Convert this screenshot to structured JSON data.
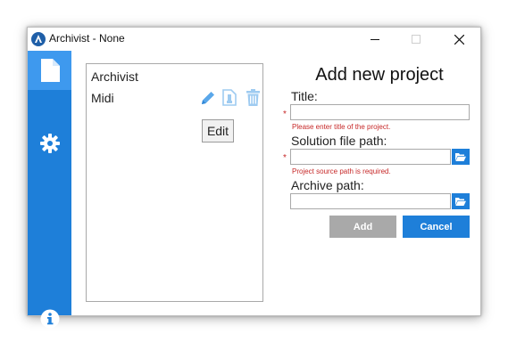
{
  "window": {
    "title": "Archivist - None",
    "controls": {
      "minimize": "minimize-icon",
      "maximize": "maximize-icon",
      "close": "close-icon"
    }
  },
  "sidebar": {
    "items": [
      {
        "name": "projects",
        "icon": "document-icon",
        "active": true
      },
      {
        "name": "settings",
        "icon": "gear-icon",
        "active": false
      },
      {
        "name": "about",
        "icon": "info-icon",
        "active": false
      }
    ]
  },
  "projects": {
    "items": [
      {
        "label": "Archivist"
      },
      {
        "label": "Midi"
      }
    ],
    "row_actions": [
      "edit-icon",
      "archive-icon",
      "delete-icon"
    ],
    "tooltip": "Edit"
  },
  "form": {
    "heading": "Add new project",
    "title_label": "Title:",
    "title_value": "",
    "title_error": "Please enter title of the project.",
    "solution_label": "Solution file path:",
    "solution_value": "",
    "solution_error": "Project source path is required.",
    "archive_label": "Archive path:",
    "archive_value": "",
    "required_mark": "*",
    "add_label": "Add",
    "cancel_label": "Cancel"
  },
  "colors": {
    "accent": "#1e7fd9",
    "accent_active": "#3e99ee",
    "disabled_button": "#a9a9a9",
    "error": "#c62828",
    "action_icon": "#5aa7ea",
    "action_icon_faded": "#9ecbf1"
  }
}
